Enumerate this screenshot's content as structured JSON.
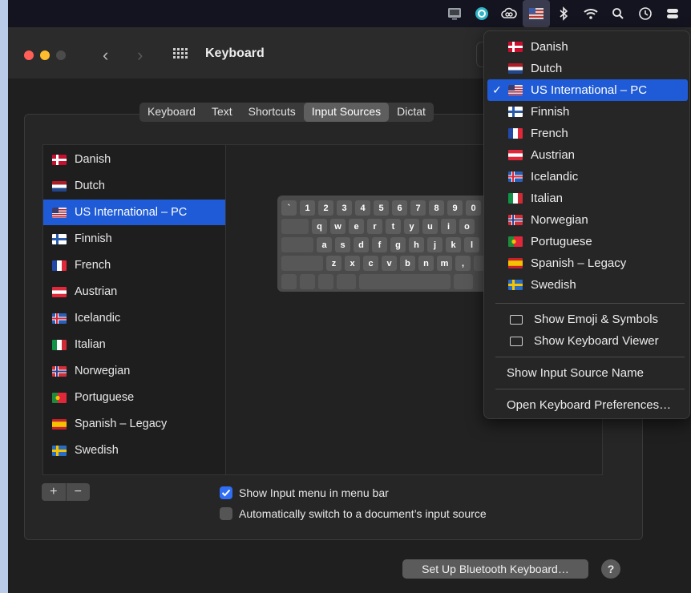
{
  "window": {
    "title": "Keyboard"
  },
  "tabs": [
    {
      "label": "Keyboard"
    },
    {
      "label": "Text"
    },
    {
      "label": "Shortcuts"
    },
    {
      "label": "Input Sources",
      "selected": true
    },
    {
      "label": "Dictat"
    }
  ],
  "sources": [
    {
      "label": "Danish",
      "flag": "danish-flag"
    },
    {
      "label": "Dutch",
      "flag": "dutch-flag"
    },
    {
      "label": "US International – PC",
      "flag": "us-flag",
      "selected": true
    },
    {
      "label": "Finnish",
      "flag": "finnish-flag"
    },
    {
      "label": "French",
      "flag": "french-flag"
    },
    {
      "label": "Austrian",
      "flag": "austrian-flag"
    },
    {
      "label": "Icelandic",
      "flag": "icelandic-flag"
    },
    {
      "label": "Italian",
      "flag": "italian-flag"
    },
    {
      "label": "Norwegian",
      "flag": "norwegian-flag"
    },
    {
      "label": "Portuguese",
      "flag": "portuguese-flag"
    },
    {
      "label": "Spanish – Legacy",
      "flag": "spanish-flag"
    },
    {
      "label": "Swedish",
      "flag": "swedish-flag"
    }
  ],
  "keyboard": {
    "row1": [
      "`",
      "1",
      "2",
      "3",
      "4",
      "5",
      "6",
      "7",
      "8",
      "9",
      "0"
    ],
    "row2": [
      "q",
      "w",
      "e",
      "r",
      "t",
      "y",
      "u",
      "i",
      "o"
    ],
    "row3": [
      "a",
      "s",
      "d",
      "f",
      "g",
      "h",
      "j",
      "k",
      "l"
    ],
    "row4": [
      "z",
      "x",
      "c",
      "v",
      "b",
      "n",
      "m",
      ","
    ]
  },
  "controls": {
    "plus": "+",
    "minus": "−",
    "show_input_menu": "Show Input menu in menu bar",
    "show_input_menu_checked": true,
    "auto_switch": "Automatically switch to a document’s input source",
    "auto_switch_checked": false,
    "bluetooth_button": "Set Up Bluetooth Keyboard…",
    "help": "?"
  },
  "menu": {
    "selected_check": "✓",
    "show_emoji": "Show Emoji & Symbols",
    "show_keyboard_viewer": "Show Keyboard Viewer",
    "show_input_source_name": "Show Input Source Name",
    "open_prefs": "Open Keyboard Preferences…"
  },
  "menubar_icons": [
    "display-icon",
    "siri-icon",
    "creative-cloud-icon",
    "input-source-flag-icon",
    "bluetooth-icon",
    "wifi-icon",
    "search-icon",
    "time-machine-icon",
    "control-center-icon"
  ],
  "colors": {
    "selection": "#1f5bd6",
    "checkbox": "#2f6ef5"
  }
}
